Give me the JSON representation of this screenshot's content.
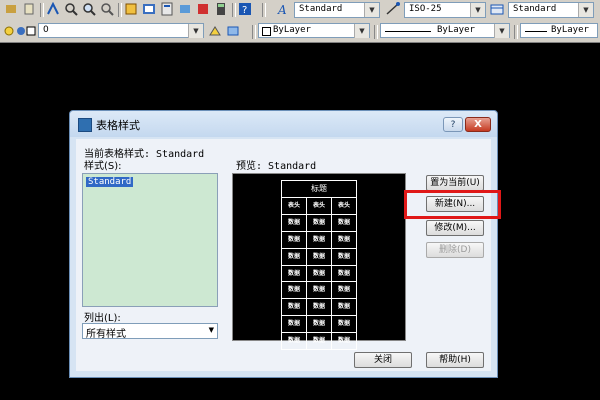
{
  "toolbar1": {
    "text_style_value": "Standard",
    "dim_style_value": "ISO-25",
    "table_style_value": "Standard"
  },
  "toolbar2": {
    "layer_value": "0",
    "color_value": "ByLayer",
    "linetype_value": "ByLayer",
    "lineweight_value": "ByLayer"
  },
  "dialog": {
    "title": "表格样式",
    "current_style_label": "当前表格样式: Standard",
    "styles_label": "样式(S):",
    "styles": [
      "Standard"
    ],
    "list_label": "列出(L):",
    "list_value": "所有样式",
    "preview_label": "预览: Standard",
    "preview_title": "标题",
    "preview_header": [
      "表头",
      "表头",
      "表头"
    ],
    "preview_rows": [
      [
        "数据",
        "数据",
        "数据"
      ],
      [
        "数据",
        "数据",
        "数据"
      ],
      [
        "数据",
        "数据",
        "数据"
      ],
      [
        "数据",
        "数据",
        "数据"
      ],
      [
        "数据",
        "数据",
        "数据"
      ],
      [
        "数据",
        "数据",
        "数据"
      ],
      [
        "数据",
        "数据",
        "数据"
      ],
      [
        "数据",
        "数据",
        "数据"
      ]
    ],
    "buttons": {
      "set_current": "置为当前(U)",
      "new": "新建(N)...",
      "modify": "修改(M)...",
      "delete": "删除(D)",
      "close": "关闭",
      "help": "帮助(H)"
    },
    "titlebar_help": "?",
    "titlebar_close": "X"
  }
}
